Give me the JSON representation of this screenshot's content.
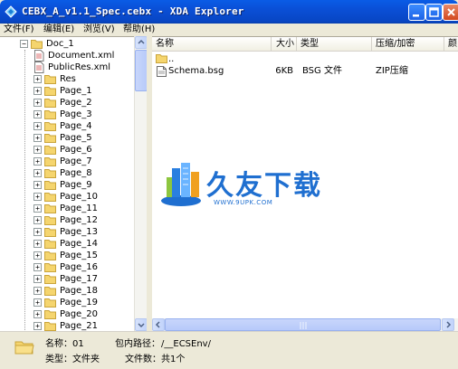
{
  "window": {
    "title": "CEBX_A_v1.1_Spec.cebx - XDA Explorer"
  },
  "menu": [
    {
      "label": "文件",
      "accel": "(F)"
    },
    {
      "label": "编辑",
      "accel": "(E)"
    },
    {
      "label": "浏览",
      "accel": "(V)"
    },
    {
      "label": "帮助",
      "accel": "(H)"
    }
  ],
  "tree": {
    "root": "Doc_1",
    "files": [
      "Document.xml",
      "PublicRes.xml"
    ],
    "folders": [
      "Res",
      "Page_1",
      "Page_2",
      "Page_3",
      "Page_4",
      "Page_5",
      "Page_6",
      "Page_7",
      "Page_8",
      "Page_9",
      "Page_10",
      "Page_11",
      "Page_12",
      "Page_13",
      "Page_14",
      "Page_15",
      "Page_16",
      "Page_17",
      "Page_18",
      "Page_19",
      "Page_20",
      "Page_21"
    ]
  },
  "list": {
    "columns": [
      "名称",
      "大小",
      "类型",
      "压缩/加密",
      "颜"
    ],
    "parent_row": "..",
    "rows": [
      {
        "name": "Schema.bsg",
        "size": "6KB",
        "type": "BSG 文件",
        "compression": "ZIP压缩"
      }
    ]
  },
  "watermark": {
    "text": "久友下载",
    "url": "WWW.9UPK.COM"
  },
  "status": {
    "name_label": "名称：",
    "name_value": "01",
    "type_label": "类型：",
    "type_value": "文件夹",
    "path_label": "包内路径：",
    "path_value": "/__ECSEnv/",
    "count_label": "文件数：",
    "count_value": "共1个"
  },
  "colors": {
    "titlebar": "#0a5ce6",
    "folder": "#f5d56e",
    "watermark_blue": "#1f6fd0"
  }
}
